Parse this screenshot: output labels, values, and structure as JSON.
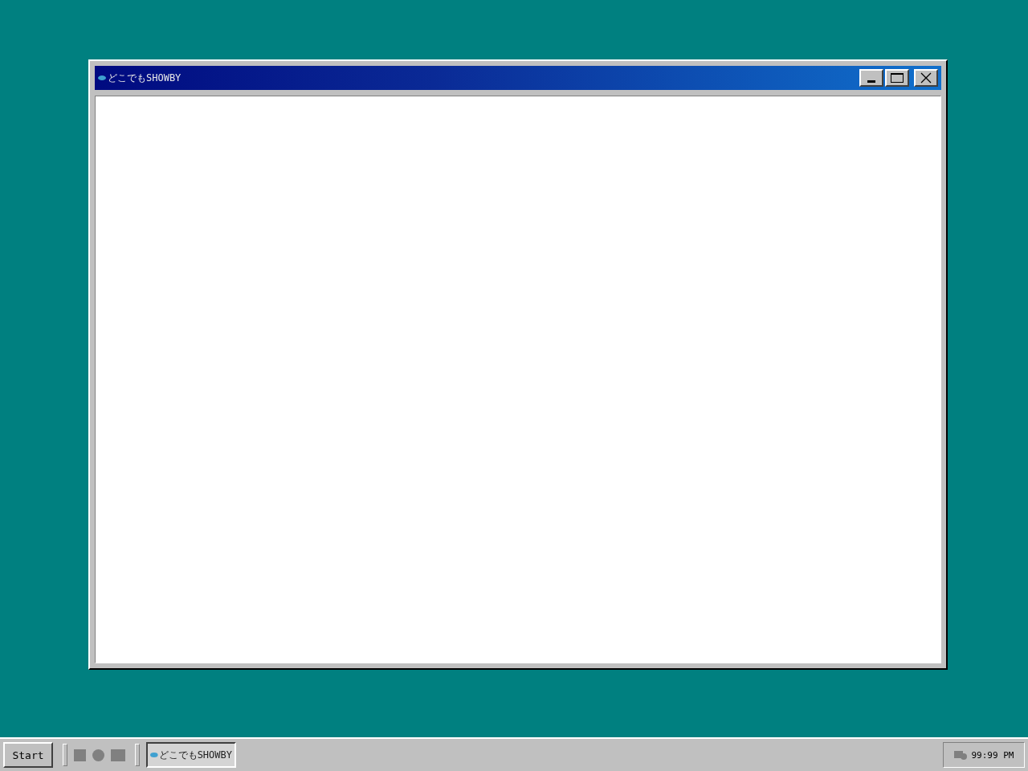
{
  "window": {
    "title": "どこでもSHOWBY"
  },
  "taskbar": {
    "start": "Start",
    "tasks": [
      {
        "label": "どこでもSHOWBY",
        "selected": true
      }
    ],
    "clock": "99:99 PM"
  }
}
